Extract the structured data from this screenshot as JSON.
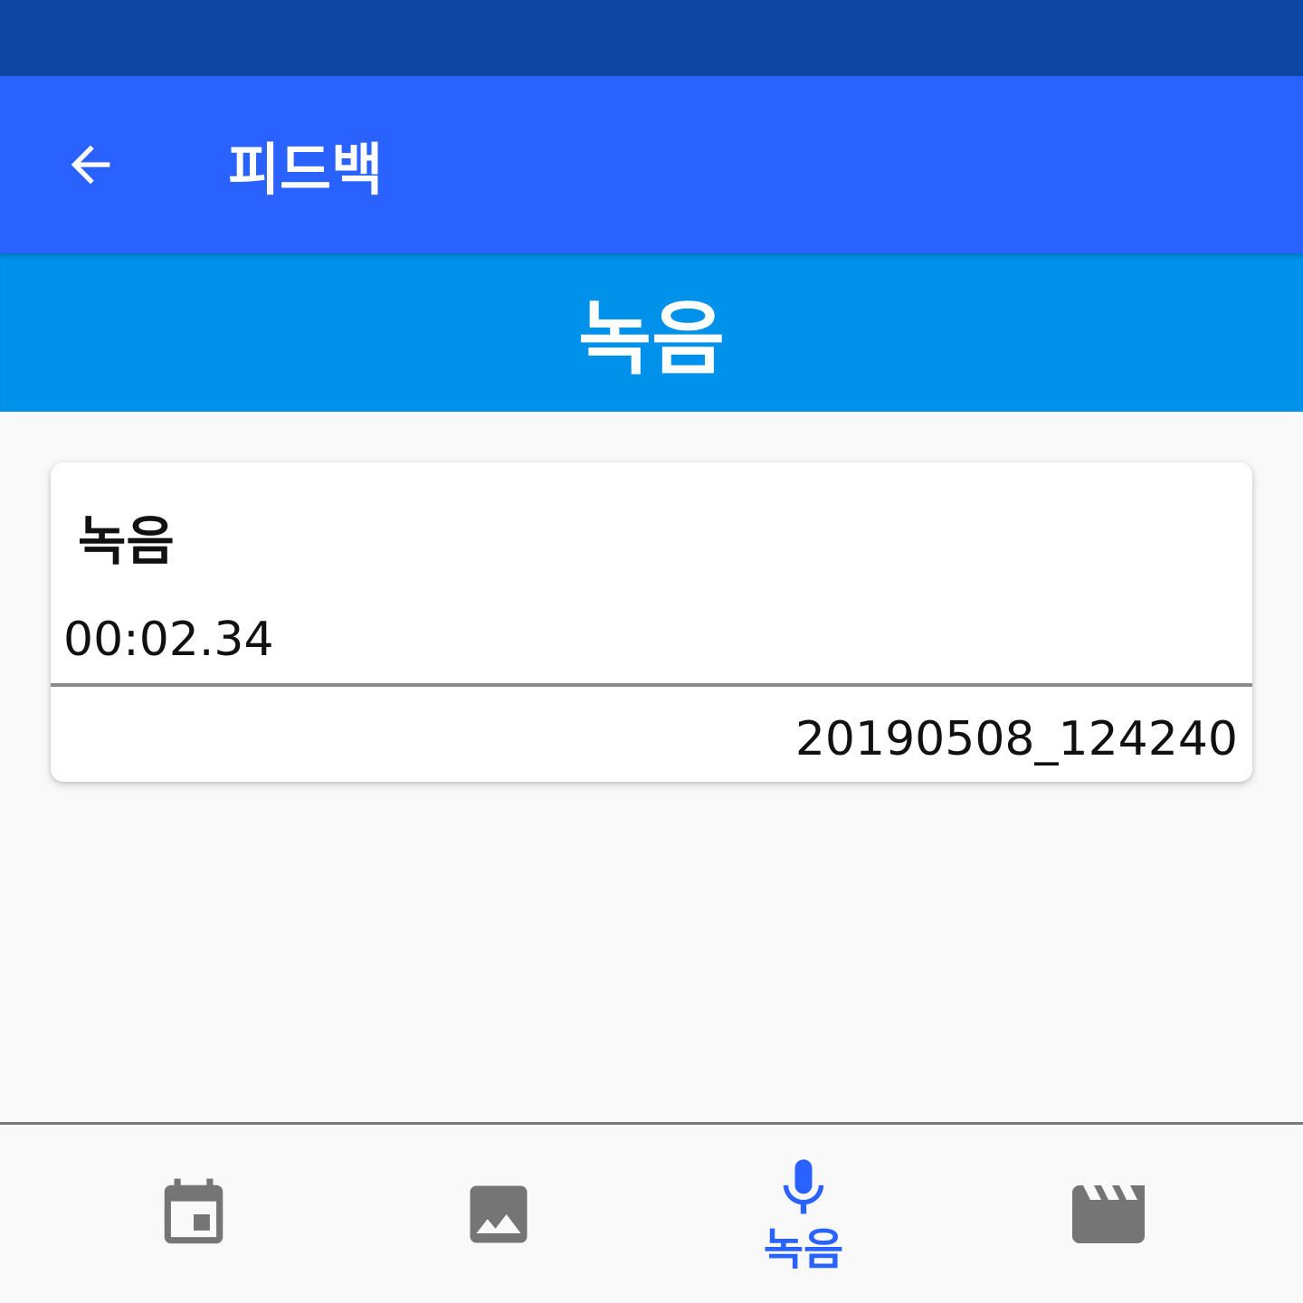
{
  "app_bar": {
    "title": "피드백",
    "back_icon": "arrow-back-icon"
  },
  "section": {
    "title": "녹음"
  },
  "recording": {
    "title": "녹음",
    "duration": "00:02.34",
    "filename": "20190508_124240"
  },
  "bottom_nav": {
    "items": [
      {
        "icon": "calendar-event-icon",
        "label": "",
        "active": false
      },
      {
        "icon": "image-icon",
        "label": "",
        "active": false
      },
      {
        "icon": "mic-icon",
        "label": "녹음",
        "active": true
      },
      {
        "icon": "movie-clapper-icon",
        "label": "",
        "active": false
      }
    ]
  },
  "colors": {
    "status_bar": "#0d47a1",
    "app_bar": "#2962ff",
    "section_header": "#0091ea",
    "active_nav": "#2962ff",
    "inactive_nav": "#757575"
  }
}
